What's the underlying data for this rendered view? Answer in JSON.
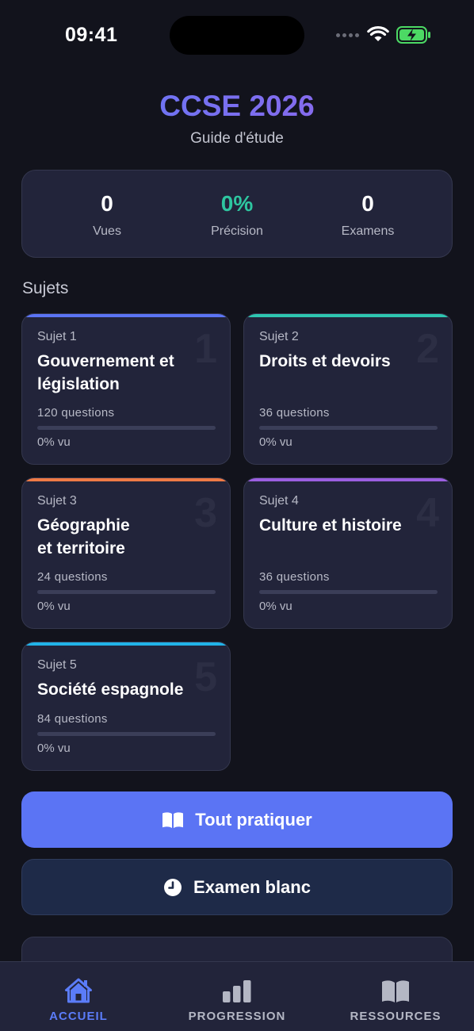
{
  "status": {
    "time": "09:41"
  },
  "header": {
    "title": "CCSE 2026",
    "subtitle": "Guide d'étude"
  },
  "stats": [
    {
      "value": "0",
      "label": "Vues",
      "accent": false
    },
    {
      "value": "0%",
      "label": "Précision",
      "accent": true
    },
    {
      "value": "0",
      "label": "Examens",
      "accent": false
    }
  ],
  "section_title": "Sujets",
  "subjects": [
    {
      "eyebrow": "Sujet 1",
      "number": "1",
      "name": "Gouvernement et législation",
      "questions": "120 questions",
      "progress": "0% vu",
      "progress_value": 0,
      "color": "#5b74f4"
    },
    {
      "eyebrow": "Sujet 2",
      "number": "2",
      "name": "Droits et devoirs",
      "questions": "36 questions",
      "progress": "0% vu",
      "progress_value": 0,
      "color": "#2ec6b0"
    },
    {
      "eyebrow": "Sujet 3",
      "number": "3",
      "name": "Géographie et territoire",
      "questions": "24 questions",
      "progress": "0% vu",
      "progress_value": 0,
      "color": "#ef7a45"
    },
    {
      "eyebrow": "Sujet 4",
      "number": "4",
      "name": "Culture et histoire",
      "questions": "36 questions",
      "progress": "0% vu",
      "progress_value": 0,
      "color": "#9b5fe0"
    },
    {
      "eyebrow": "Sujet 5",
      "number": "5",
      "name": "Société espagnole",
      "questions": "84 questions",
      "progress": "0% vu",
      "progress_value": 0,
      "color": "#21b3e8"
    }
  ],
  "actions": {
    "practice_all": {
      "label": "Tout pratiquer",
      "icon": "book-open-icon"
    },
    "mock_exam": {
      "label": "Examen blanc",
      "icon": "clock-icon"
    }
  },
  "tabs": [
    {
      "label": "ACCUEIL",
      "icon": "home-icon",
      "active": true
    },
    {
      "label": "PROGRESSION",
      "icon": "bar-chart-icon",
      "active": false
    },
    {
      "label": "RESSOURCES",
      "icon": "book-icon",
      "active": false
    }
  ],
  "colors": {
    "accent": "#5b74f4",
    "success": "#2ec6a0",
    "background": "#12131c",
    "card": "#22243a"
  }
}
